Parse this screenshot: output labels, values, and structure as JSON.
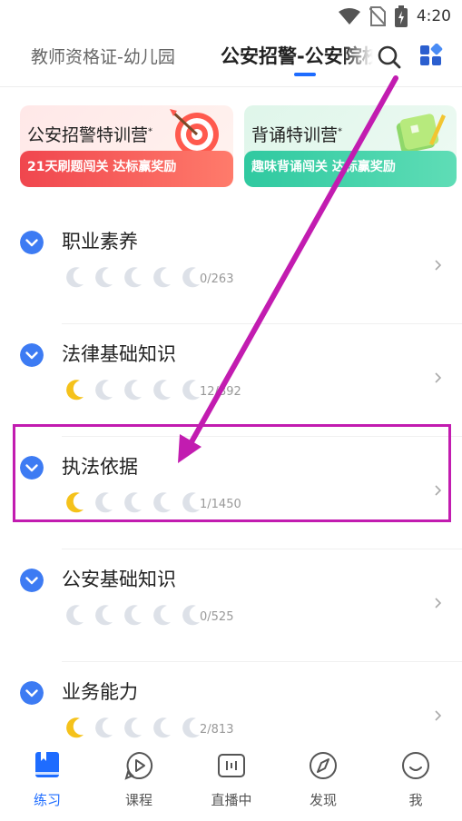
{
  "status": {
    "time": "4:20"
  },
  "header": {
    "tab_left": "教师资格证-幼儿园",
    "tab_active": "公安招警-公安院校",
    "search_icon": "search-icon",
    "apps_icon": "grid-icon"
  },
  "promos": [
    {
      "title": "公安招警特训营",
      "subtitle": "21天刷题闯关 达标赢奖励",
      "icon": "target-icon"
    },
    {
      "title": "背诵特训营",
      "subtitle": "趣味背诵闯关 达标赢奖励",
      "icon": "book-icon"
    }
  ],
  "items": [
    {
      "title": "职业素养",
      "count": "0/263",
      "moons": [
        0,
        0,
        0,
        0,
        0
      ]
    },
    {
      "title": "法律基础知识",
      "count": "12/892",
      "moons": [
        1,
        0,
        0,
        0,
        0
      ]
    },
    {
      "title": "执法依据",
      "count": "1/1450",
      "moons": [
        1,
        0,
        0,
        0,
        0
      ]
    },
    {
      "title": "公安基础知识",
      "count": "0/525",
      "moons": [
        0,
        0,
        0,
        0,
        0
      ]
    },
    {
      "title": "业务能力",
      "count": "2/813",
      "moons": [
        1,
        0,
        0,
        0,
        0
      ]
    }
  ],
  "nav": [
    {
      "label": "练习",
      "icon": "practice-icon",
      "active": true
    },
    {
      "label": "课程",
      "icon": "play-icon",
      "active": false
    },
    {
      "label": "直播中",
      "icon": "live-icon",
      "active": false
    },
    {
      "label": "发现",
      "icon": "compass-icon",
      "active": false
    },
    {
      "label": "我",
      "icon": "profile-icon",
      "active": false
    }
  ],
  "colors": {
    "accent": "#1e6cff",
    "chevron": "#3d7bf3",
    "annotation": "#c21cb0",
    "moon_lit": "#f5c21b",
    "moon_dim": "#dde1e8"
  }
}
